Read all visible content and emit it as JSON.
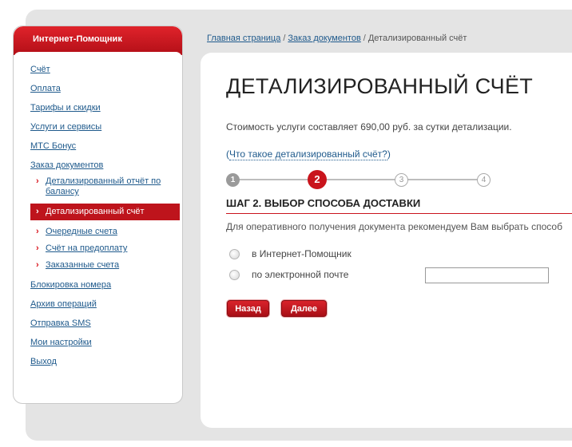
{
  "sidebar": {
    "title": "Интернет-Помощник",
    "items": [
      {
        "label": "Счёт"
      },
      {
        "label": "Оплата"
      },
      {
        "label": "Тарифы и скидки"
      },
      {
        "label": "Услуги и сервисы"
      },
      {
        "label": "МТС Бонус"
      },
      {
        "label": "Заказ документов"
      }
    ],
    "subitems": [
      {
        "label": "Детализированный отчёт по балансу"
      },
      {
        "label": "Детализированный счёт"
      },
      {
        "label": "Очередные счета"
      },
      {
        "label": "Счёт на предоплату"
      },
      {
        "label": "Заказанные счета"
      }
    ],
    "items_after": [
      {
        "label": "Блокировка номера"
      },
      {
        "label": "Архив операций"
      },
      {
        "label": "Отправка SMS"
      },
      {
        "label": "Мои настройки"
      },
      {
        "label": "Выход"
      }
    ]
  },
  "breadcrumb": {
    "home": "Главная страница",
    "orders": "Заказ документов",
    "current": "Детализированный счёт",
    "separator": "/"
  },
  "main": {
    "title": "ДЕТАЛИЗИРОВАННЫЙ СЧЁТ",
    "cost_text": "Стоимость услуги составляет 690,00 руб. за сутки детализации.",
    "what_is_link_open": "(",
    "what_is_link": "Что такое детализированный счёт?",
    "what_is_link_close": ")",
    "steps": [
      "1",
      "2",
      "3",
      "4"
    ],
    "current_step": 2,
    "step_heading": "ШАГ 2. ВЫБОР СПОСОБА ДОСТАВКИ",
    "recommend_text": "Для оперативного получения документа рекомендуем Вам выбрать способ",
    "option_assistant": "в Интернет-Помощник",
    "option_email": "по электронной почте",
    "email_value": "",
    "back_button": "Назад",
    "next_button": "Далее"
  },
  "colors": {
    "accent": "#c9141c",
    "link": "#1f5a8c"
  }
}
